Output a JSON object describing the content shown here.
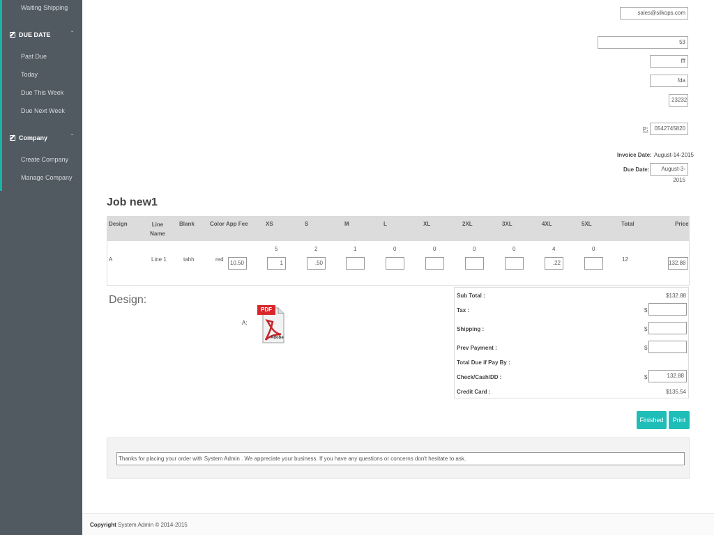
{
  "sidebar": {
    "top_item": "Waiting Shipping",
    "sections": [
      {
        "title": "DUE DATE",
        "items": [
          "Past Due",
          "Today",
          "Due This Week",
          "Due Next Week"
        ]
      },
      {
        "title": "Company",
        "items": [
          "Create Company",
          "Manage Company"
        ]
      }
    ]
  },
  "header_fields": {
    "email": "sales@silkops.com",
    "field_53": "53",
    "field_fff": "fff",
    "field_fda": "fda",
    "zip": "23232",
    "phone_label": "P:",
    "phone": "0542745820",
    "invoice_date_label": "Invoice Date:",
    "invoice_date": "August-14-2015",
    "due_date_label": "Due Date:",
    "due_date": "August-3-2015"
  },
  "job": {
    "title": "Job new1",
    "headers": [
      "Design",
      "Line Name",
      "Blank",
      "Color",
      "App Fee",
      "XS",
      "S",
      "M",
      "L",
      "XL",
      "2XL",
      "3XL",
      "4XL",
      "5XL",
      "Total",
      "Price"
    ],
    "row": {
      "design": "A",
      "line_name": "Line 1",
      "blank": "tahh",
      "color": "red",
      "app_fee": "10.50",
      "sizes": [
        {
          "qty": "5",
          "input": "1"
        },
        {
          "qty": "2",
          "input": ".50"
        },
        {
          "qty": "1",
          "input": ""
        },
        {
          "qty": "0",
          "input": ""
        },
        {
          "qty": "0",
          "input": ""
        },
        {
          "qty": "0",
          "input": ""
        },
        {
          "qty": "0",
          "input": ""
        },
        {
          "qty": "4",
          "input": ".22"
        },
        {
          "qty": "0",
          "input": ""
        }
      ],
      "total": "12",
      "price": "132.88"
    }
  },
  "design": {
    "title": "Design:",
    "label": "A:",
    "icon": "pdf-icon",
    "pdf_badge": "PDF",
    "adobe_text": "Adobe"
  },
  "summary": {
    "subtotal_label": "Sub Total :",
    "subtotal": "$132.88",
    "tax_label": "Tax :",
    "tax": "",
    "shipping_label": "Shipping :",
    "shipping": "",
    "prev_payment_label": "Prev Payment :",
    "prev_payment": "",
    "total_due_label": "Total Due if Pay By :",
    "check_label": "Check/Cash/DD :",
    "check": "132.88",
    "credit_label": "Credit Card :",
    "credit": "$135.54",
    "currency": "$"
  },
  "buttons": {
    "finished": "Finished",
    "print": "Print"
  },
  "thanks": "Thanks for placing your order with System Admin . We appreciate your business. If you have any questions or concerns don't hesitate to ask.",
  "footer": {
    "copyright": "Copyright",
    "text": "System Admin © 2014-2015"
  },
  "colors": {
    "sidebar": "#515961",
    "accent": "#16b5a5",
    "button": "#1fbdb8"
  }
}
